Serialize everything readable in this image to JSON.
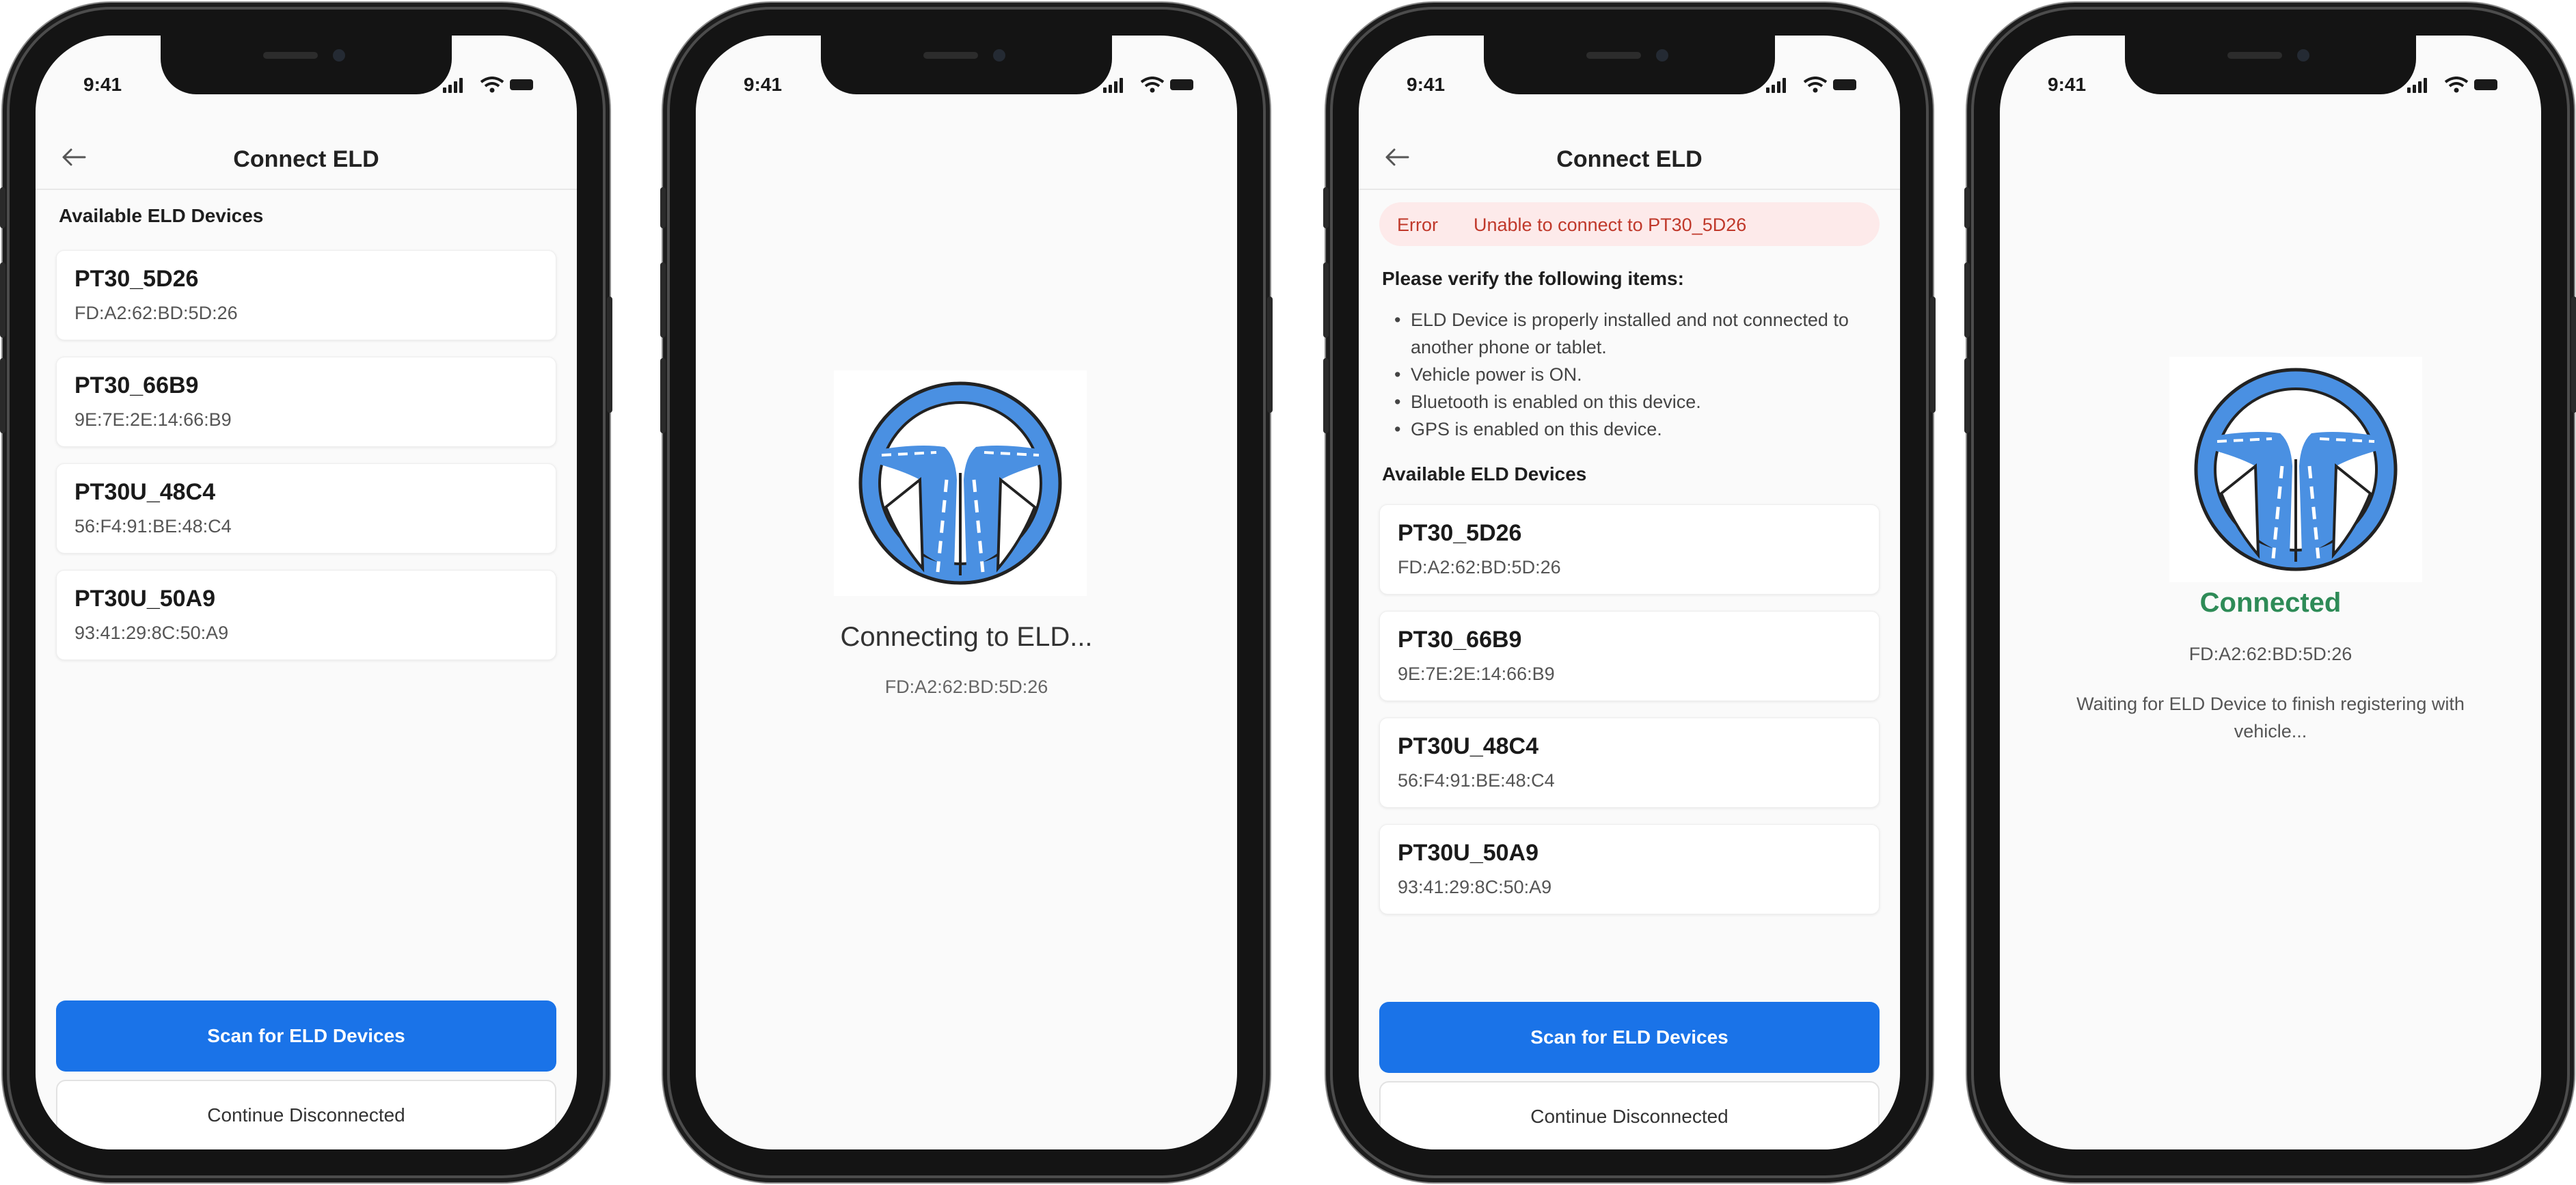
{
  "status_bar": {
    "time": "9:41"
  },
  "colors": {
    "primary": "#1a73e8",
    "success": "#2e8b57",
    "error": "#c0392b",
    "logo_blue": "#4a90e2"
  },
  "screens": [
    {
      "title": "Connect ELD",
      "section_label": "Available ELD Devices",
      "devices": [
        {
          "name": "PT30_5D26",
          "mac": "FD:A2:62:BD:5D:26"
        },
        {
          "name": "PT30_66B9",
          "mac": "9E:7E:2E:14:66:B9"
        },
        {
          "name": "PT30U_48C4",
          "mac": "56:F4:91:BE:48:C4"
        },
        {
          "name": "PT30U_50A9",
          "mac": "93:41:29:8C:50:A9"
        }
      ],
      "scan_button": "Scan for ELD Devices",
      "continue_button": "Continue Disconnected"
    },
    {
      "status_text": "Connecting to ELD...",
      "mac": "FD:A2:62:BD:5D:26"
    },
    {
      "title": "Connect ELD",
      "error_tag": "Error",
      "error_message": "Unable to connect to PT30_5D26",
      "verify_heading": "Please verify the following items:",
      "verify_items": [
        "ELD Device is properly installed and not connected to another phone or tablet.",
        "Vehicle power is ON.",
        "Bluetooth is enabled on this device.",
        "GPS is enabled on this device."
      ],
      "section_label": "Available ELD Devices",
      "devices": [
        {
          "name": "PT30_5D26",
          "mac": "FD:A2:62:BD:5D:26"
        },
        {
          "name": "PT30_66B9",
          "mac": "9E:7E:2E:14:66:B9"
        },
        {
          "name": "PT30U_48C4",
          "mac": "56:F4:91:BE:48:C4"
        },
        {
          "name": "PT30U_50A9",
          "mac": "93:41:29:8C:50:A9"
        }
      ],
      "scan_button": "Scan for ELD Devices",
      "continue_button": "Continue Disconnected"
    },
    {
      "status_text": "Connected",
      "mac": "FD:A2:62:BD:5D:26",
      "message": "Waiting for ELD Device to finish registering with vehicle..."
    }
  ]
}
